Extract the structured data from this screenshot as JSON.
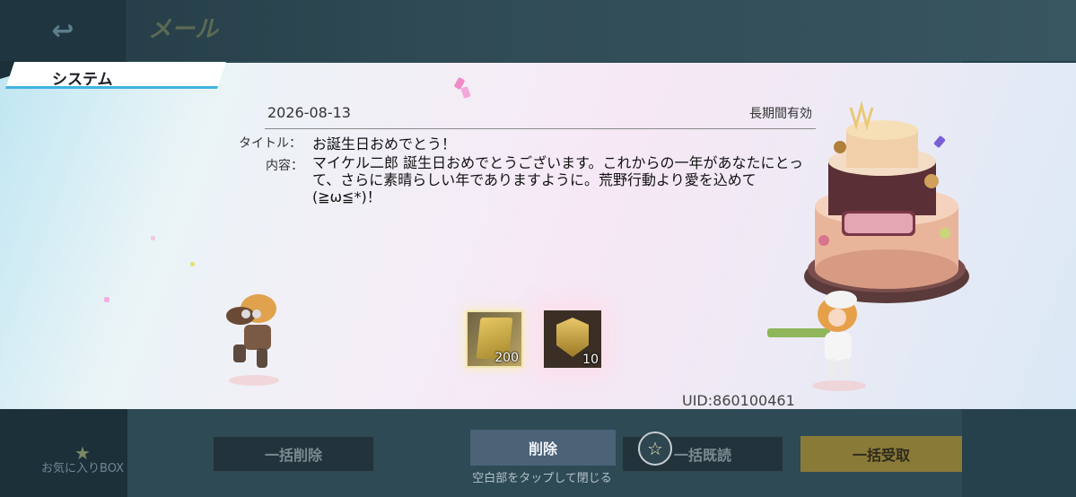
{
  "header": {
    "back_icon": "back-arrow-icon",
    "title": "メール"
  },
  "sidebar": {
    "favorites_label": "お気に入りBOX",
    "favorites_icon": "star-icon"
  },
  "mail": {
    "category_tab": "システム",
    "date": "2026-08-13",
    "validity": "長期間有効",
    "title_label": "タイトル：",
    "title_value": "お誕生日おめでとう！",
    "body_label": "内容：",
    "body_value": "マイケル二郎 誕生日おめでとうございます。これからの一年があなたにとって、さらに素晴らしい年でありますように。荒野行動より愛を込めて(≧ω≦*)！",
    "uid": "UID:860100461",
    "attachments": [
      {
        "name": "gold-book-item",
        "icon": "gold-book-icon",
        "quantity": "200"
      },
      {
        "name": "rank-badge-item",
        "icon": "rank-badge-icon",
        "quantity": "10"
      }
    ]
  },
  "actions": {
    "delete_all": "一括削除",
    "delete": "削除",
    "read_all": "一括既読",
    "receive_all": "一括受取",
    "favorite_icon": "star-outline-icon",
    "close_hint": "空白部をタップして閉じる"
  },
  "colors": {
    "accent_blue": "#39b5e3",
    "receive_gold": "#8a7a38",
    "delete_button": "#4b6277"
  }
}
